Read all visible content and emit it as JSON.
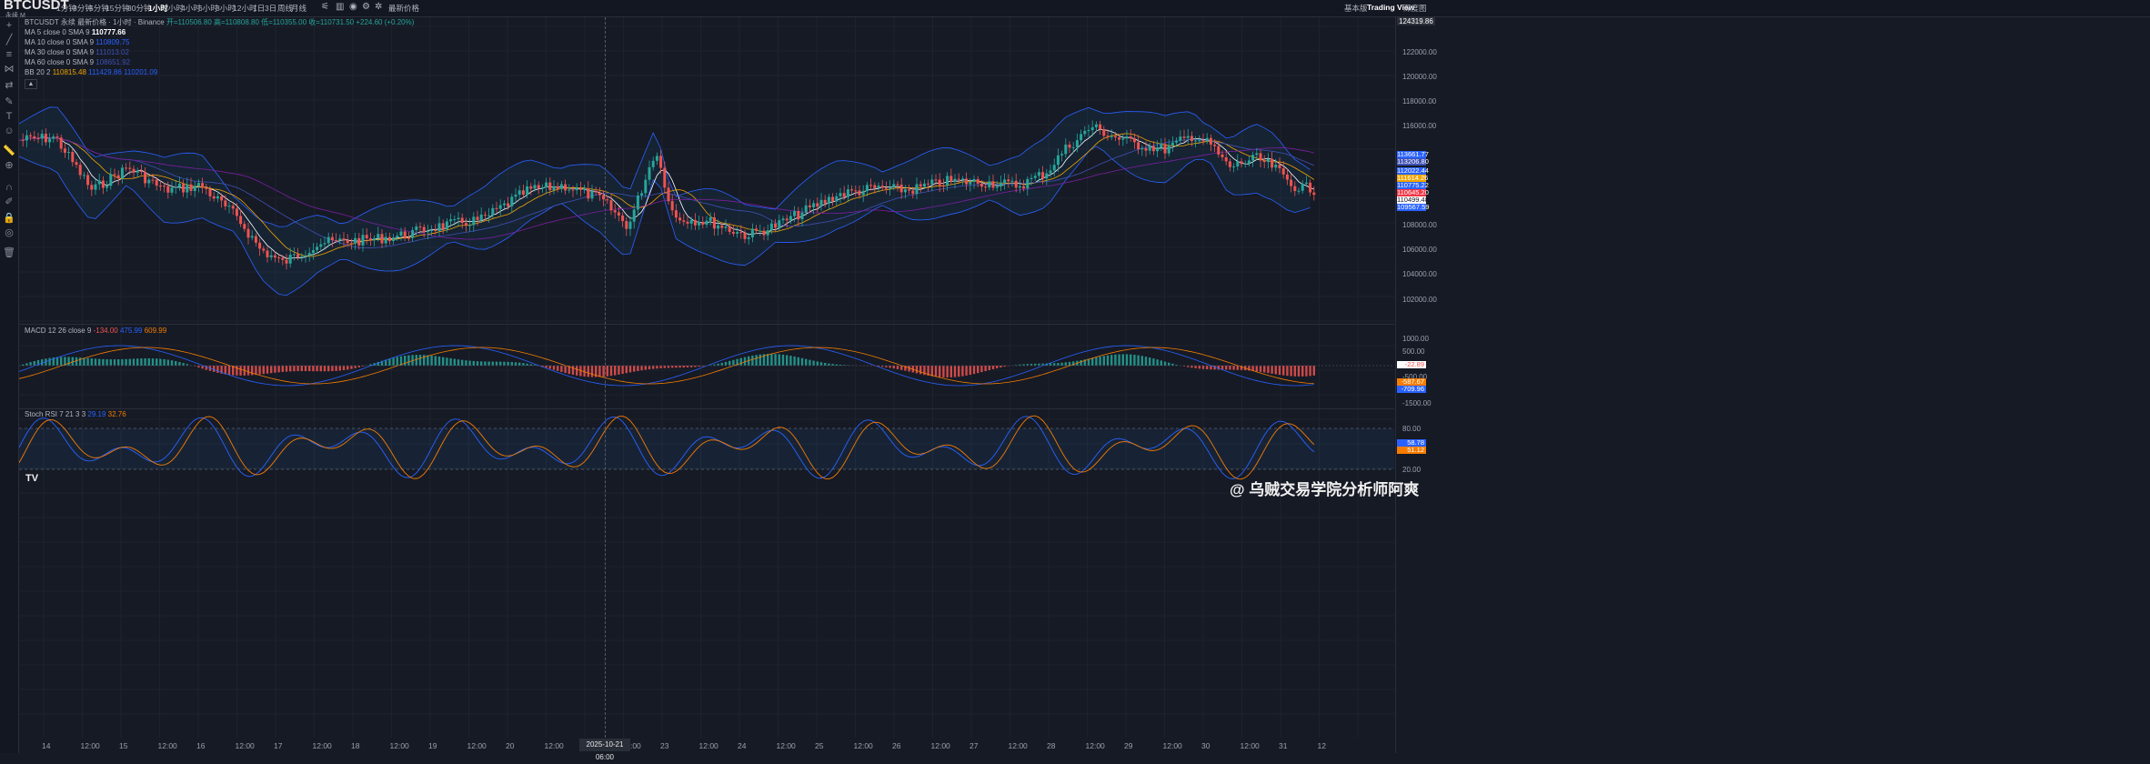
{
  "topbar": {
    "symbol": "BTCUSDT",
    "symbol_sub": "永续 M",
    "timeframes": [
      "1分钟",
      "3分钟",
      "5分钟",
      "15分钟",
      "30分钟",
      "1小时",
      "2小时",
      "4小时",
      "6小时",
      "8小时",
      "12小时",
      "1日",
      "3日",
      "周线",
      "月线"
    ],
    "active_timeframe": "1小时",
    "price_type": "最新价格",
    "right_tabs": [
      "基本版",
      "Trading View",
      "深度图"
    ]
  },
  "legend": {
    "main": "BTCUSDT 永续 最新价格 · 1小时 · Binance",
    "ohlc": "开=110506.80 高=110808.80 低=110355.00 收=110731.50 +224.60 (+0.20%)",
    "ma5_label": "MA 5 close 0 SMA 9",
    "ma5_value": "110777.66",
    "ma10_label": "MA 10 close 0 SMA 9",
    "ma10_value": "110809.75",
    "ma30_label": "MA 30 close 0 SMA 9",
    "ma30_value": "111013.02",
    "ma60_label": "MA 60 close 0 SMA 9",
    "ma60_value": "108651.92",
    "bb_label": "BB 20 2",
    "bb_basis": "110815.48",
    "bb_upper": "111429.86",
    "bb_lower": "110201.09",
    "macd_label": "MACD 12 26 close 9",
    "macd_hist": "-134.00",
    "macd_line": "475.99",
    "macd_signal": "609.99",
    "stoch_label": "Stoch RSI 7 21 3 3",
    "stoch_k": "29.19",
    "stoch_d": "32.76"
  },
  "price_axis": {
    "labels": [
      "124319.86",
      "122000.00",
      "120000.00",
      "118000.00",
      "116000.00",
      "108000.00",
      "106000.00",
      "104000.00",
      "102000.00"
    ],
    "tags": [
      {
        "text": "113661.77",
        "color": "#2962ff"
      },
      {
        "text": "113206.80",
        "color": "#3f51b5"
      },
      {
        "text": "112022.44",
        "color": "#2962ff"
      },
      {
        "text": "111614.26",
        "color": "#f0a500"
      },
      {
        "text": "110775.22",
        "color": "#2962ff"
      },
      {
        "text": "110645.20",
        "color": "#f23645"
      },
      {
        "text": "110499.48",
        "color": "#ffffff"
      },
      {
        "text": "109567.59",
        "color": "#2962ff"
      }
    ]
  },
  "macd_axis": {
    "labels": [
      "1000.00",
      "500.00",
      "-500.00",
      "-1500.00"
    ],
    "tags": [
      {
        "text": "-22.89",
        "color": "#ffffff"
      },
      {
        "text": "-587.67",
        "color": "#f57c00"
      },
      {
        "text": "-709.96",
        "color": "#2962ff"
      }
    ]
  },
  "stoch_axis": {
    "labels": [
      "80.00",
      "20.00"
    ],
    "tags": [
      {
        "text": "58.78",
        "color": "#2962ff"
      },
      {
        "text": "51.12",
        "color": "#f57c00"
      }
    ]
  },
  "x_axis": {
    "labels": [
      "14",
      "12:00",
      "15",
      "12:00",
      "16",
      "12:00",
      "17",
      "12:00",
      "18",
      "12:00",
      "19",
      "12:00",
      "20",
      "12:00",
      "22",
      "12:00",
      "23",
      "12:00",
      "24",
      "12:00",
      "25",
      "12:00",
      "26",
      "12:00",
      "27",
      "12:00",
      "28",
      "12:00",
      "29",
      "12:00",
      "30",
      "12:00",
      "31",
      "12"
    ],
    "crosshair": "2025-10-21   06:00"
  },
  "watermark": "@ 乌贼交易学院分析师阿爽",
  "tv_logo": "TV",
  "colors": {
    "up": "#26a69a",
    "down": "#ef5350",
    "bg": "#161a25",
    "grid": "#1f2330"
  },
  "icons": [
    "crosshair-icon",
    "trendline-icon",
    "fib-icon",
    "pattern-icon",
    "brush-icon",
    "text-icon",
    "emoji-icon",
    "ruler-icon",
    "zoom-icon",
    "magnet-icon",
    "lock-icon",
    "eye-icon",
    "trash-icon"
  ]
}
